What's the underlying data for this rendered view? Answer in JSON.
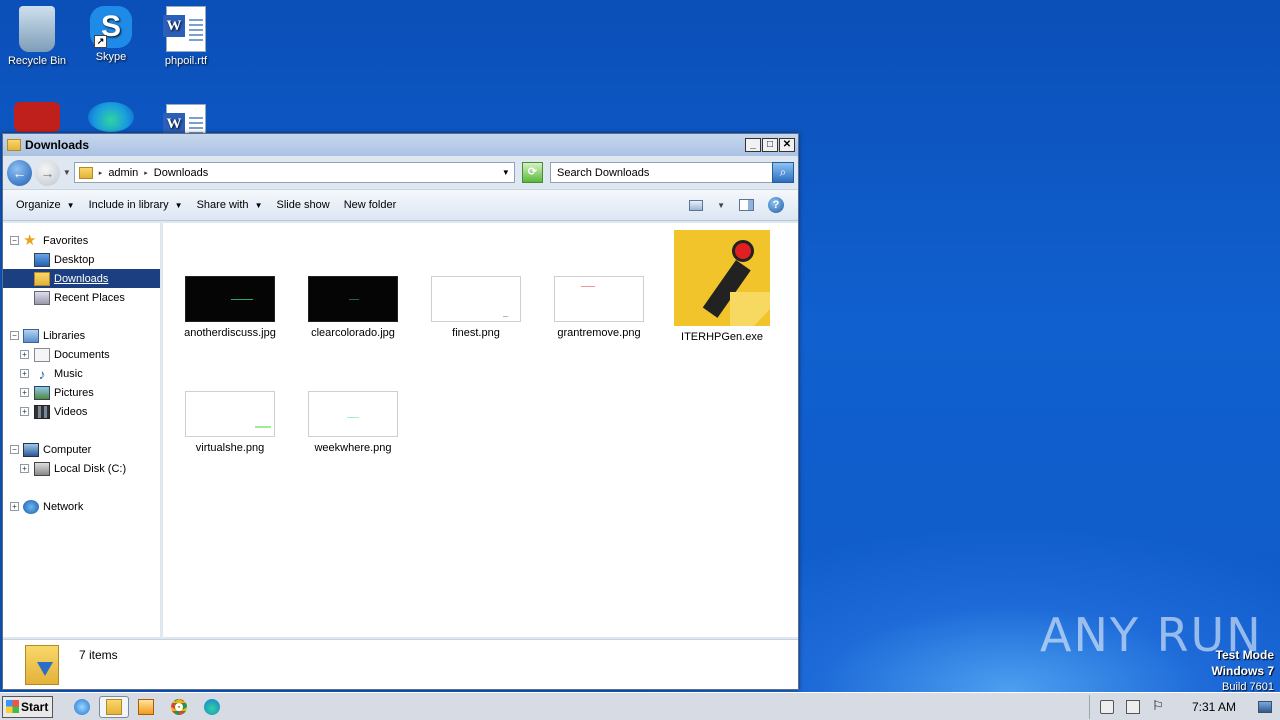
{
  "desktop": {
    "icons": [
      {
        "label": "Recycle Bin"
      },
      {
        "label": "Skype"
      },
      {
        "label": "phpoil.rtf"
      }
    ]
  },
  "window": {
    "title": "Downloads",
    "breadcrumb": [
      "admin",
      "Downloads"
    ],
    "search_placeholder": "Search Downloads",
    "toolbar": {
      "organize": "Organize",
      "include": "Include in library",
      "share": "Share with",
      "slideshow": "Slide show",
      "newfolder": "New folder"
    },
    "nav": {
      "favorites": "Favorites",
      "desktop": "Desktop",
      "downloads": "Downloads",
      "recent": "Recent Places",
      "libraries": "Libraries",
      "documents": "Documents",
      "music": "Music",
      "pictures": "Pictures",
      "videos": "Videos",
      "computer": "Computer",
      "localdisk": "Local Disk (C:)",
      "network": "Network"
    },
    "files": [
      {
        "name": "anotherdiscuss.jpg"
      },
      {
        "name": "clearcolorado.jpg"
      },
      {
        "name": "finest.png"
      },
      {
        "name": "grantremove.png"
      },
      {
        "name": "ITERHPGen.exe"
      },
      {
        "name": "virtualshe.png"
      },
      {
        "name": "weekwhere.png"
      }
    ],
    "status": "7 items"
  },
  "taskbar": {
    "start": "Start",
    "clock": "7:31 AM"
  },
  "overlay": {
    "watermark": "ANY RUN",
    "testmode": "Test Mode",
    "os": "Windows 7",
    "build": "Build 7601"
  }
}
